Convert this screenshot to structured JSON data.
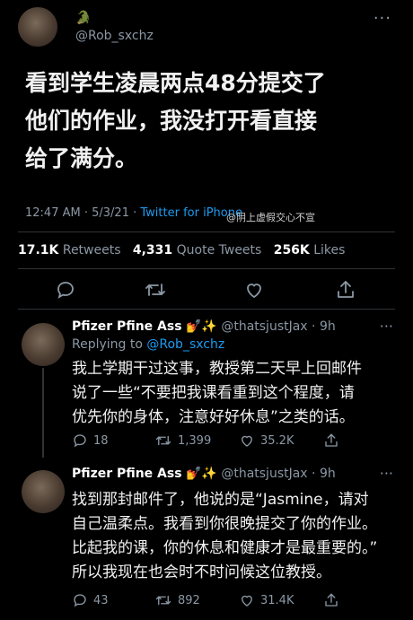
{
  "author": {
    "name_emoji": "🐊",
    "handle": "@Rob_sxchz"
  },
  "tweet": {
    "text_lines": [
      "看到学生凌晨两点48分提交了",
      "他们的作业，我没打开看直接",
      "给了满分。"
    ],
    "time": "12:47 AM",
    "date": "5/3/21",
    "source": "Twitter for iPhone",
    "watermark": "@阴上虚假交心不宣",
    "retweets": "17.1K",
    "retweets_label": "Retweets",
    "quotes": "4,331",
    "quotes_label": "Quote Tweets",
    "likes": "256K",
    "likes_label": "Likes"
  },
  "replies": [
    {
      "name": "Pfizer Pfine Ass",
      "name_emojis": "💅✨",
      "handle": "@thatsjustJax",
      "age": "9h",
      "replying_prefix": "Replying to",
      "replying_to": "@Rob_sxchz",
      "text_lines": [
        "我上学期干过这事，教授第二天早上回邮件",
        "说了一些“不要把我课看重到这个程度，请",
        "优先你的身体，注意好好休息”之类的话。"
      ],
      "replies": "18",
      "retweets": "1,399",
      "likes": "35.2K"
    },
    {
      "name": "Pfizer Pfine Ass",
      "name_emojis": "💅✨",
      "handle": "@thatsjustJax",
      "age": "9h",
      "text_lines": [
        "找到那封邮件了，他说的是“Jasmine，请对",
        "自己温柔点。我看到你很晚提交了你的作业。",
        "比起我的课，你的休息和健康才是最重要的。”",
        "所以我现在也会时不时问候这位教授。"
      ],
      "replies": "43",
      "retweets": "892",
      "likes": "31.4K"
    }
  ],
  "colors": {
    "background": "#000000",
    "text": "#e7e9ea",
    "muted": "#8b98a5",
    "link": "#1d9bf0",
    "divider": "#2f3336"
  }
}
